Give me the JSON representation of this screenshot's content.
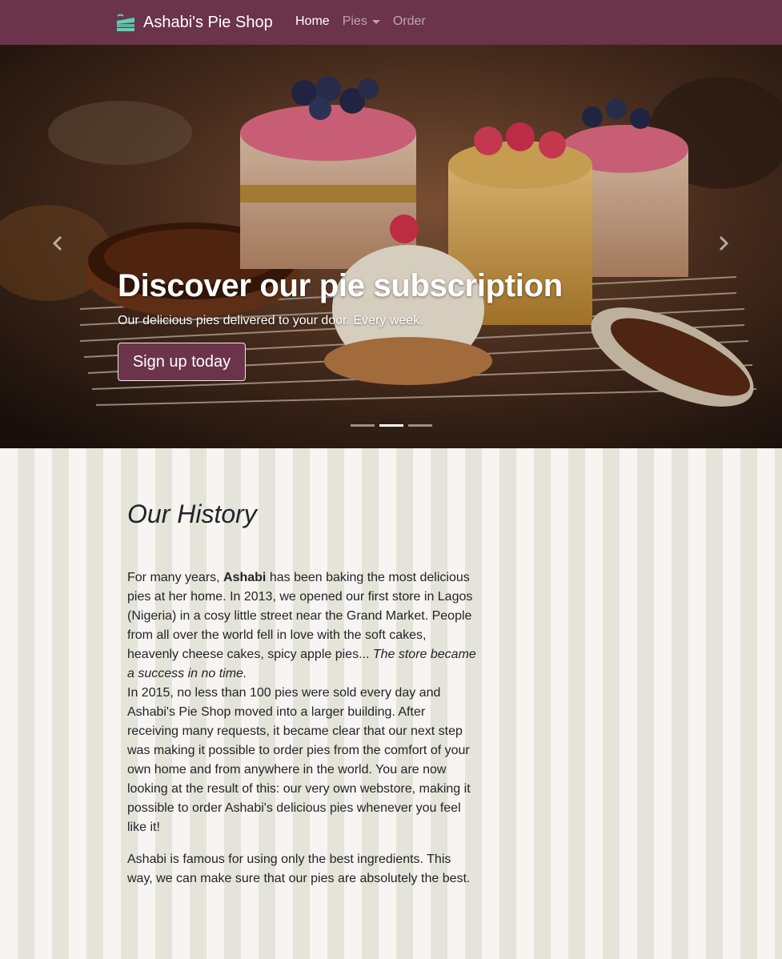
{
  "navbar": {
    "brand": "Ashabi's Pie Shop",
    "links": [
      {
        "label": "Home",
        "active": true
      },
      {
        "label": "Pies",
        "dropdown": true
      },
      {
        "label": "Order"
      }
    ],
    "background": "#6b344a"
  },
  "carousel": {
    "heading": "Discover our pie subscription",
    "subtext": "Our delicious pies delivered to your door. Every week.",
    "button": "Sign up today",
    "slide_count": 3,
    "active_slide": 2
  },
  "history": {
    "title": "Our History",
    "p1_before": "For many years, ",
    "p1_bold": "Ashabi",
    "p1_middle": " has been baking the most delicious pies at her home. In 2013, we opened our first store in Lagos (Nigeria) in a cosy little street near the Grand Market. People from all over the world fell in love with the soft cakes, heavenly cheese cakes, spicy apple pies... ",
    "p1_italic": "The store became a success in no time.",
    "p2": "In 2015, no less than 100 pies were sold every day and Ashabi's Pie Shop moved into a larger building. After receiving many requests, it became clear that our next step was making it possible to order pies from the comfort of your own home and from anywhere in the world. You are now looking at the result of this: our very own webstore, making it possible to order Ashabi's delicious pies whenever you feel like it!",
    "p3": "Ashabi is famous for using only the best ingredients. This way, we can make sure that our pies are absolutely the best."
  },
  "colors": {
    "brand": "#6b344a",
    "stripe_light": "#f7f4f1",
    "stripe_dark": "#e5e4da",
    "logo_teal": "#5fd0b0"
  },
  "icons": [
    "pie-logo-icon",
    "caret-down-icon",
    "chevron-left-icon",
    "chevron-right-icon"
  ]
}
